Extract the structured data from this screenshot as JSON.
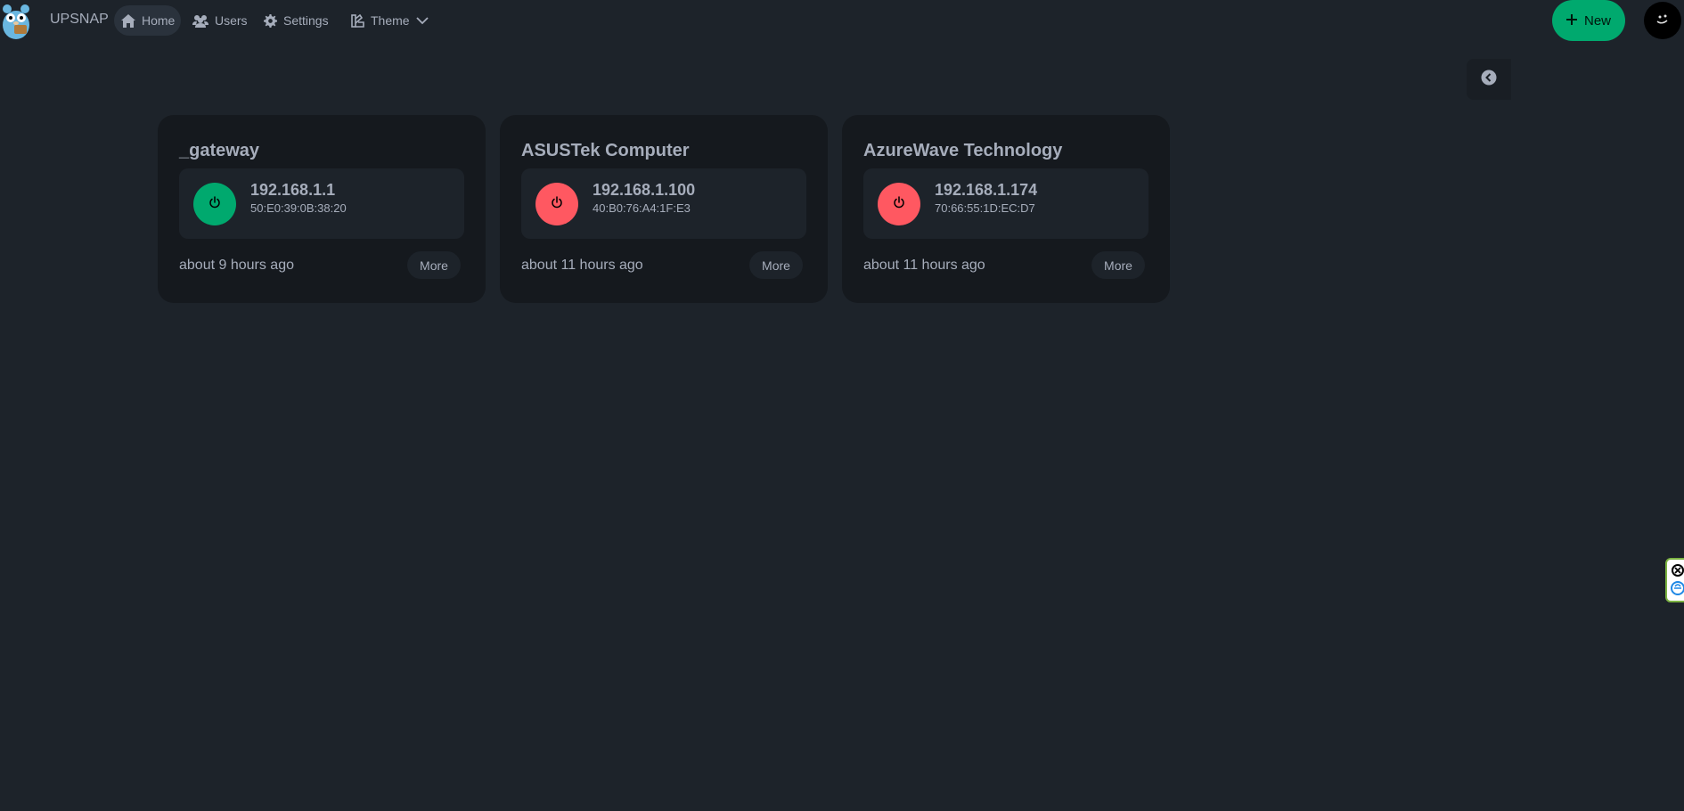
{
  "app": {
    "brand": "UPSNAP"
  },
  "nav": {
    "home": "Home",
    "users": "Users",
    "settings": "Settings",
    "theme": "Theme"
  },
  "actions": {
    "new_label": "New"
  },
  "colors": {
    "accent": "#00a96e",
    "online": "#00a96e",
    "offline": "#ff5861",
    "background": "#1d232a",
    "card": "#15191e"
  },
  "devices": [
    {
      "name": "_gateway",
      "ip": "192.168.1.1",
      "mac": "50:E0:39:0B:38:20",
      "last_seen": "about 9 hours ago",
      "more_label": "More",
      "status": "online"
    },
    {
      "name": "ASUSTek Computer",
      "ip": "192.168.1.100",
      "mac": "40:B0:76:A4:1F:E3",
      "last_seen": "about 11 hours ago",
      "more_label": "More",
      "status": "offline"
    },
    {
      "name": "AzureWave Technology",
      "ip": "192.168.1.174",
      "mac": "70:66:55:1D:EC:D7",
      "last_seen": "about 11 hours ago",
      "more_label": "More",
      "status": "offline"
    }
  ],
  "icons": {
    "home": "home-icon",
    "users": "users-icon",
    "settings": "gear-icon",
    "theme": "palette-icon",
    "power": "power-icon",
    "collapse": "chevron-left-circle-icon"
  }
}
